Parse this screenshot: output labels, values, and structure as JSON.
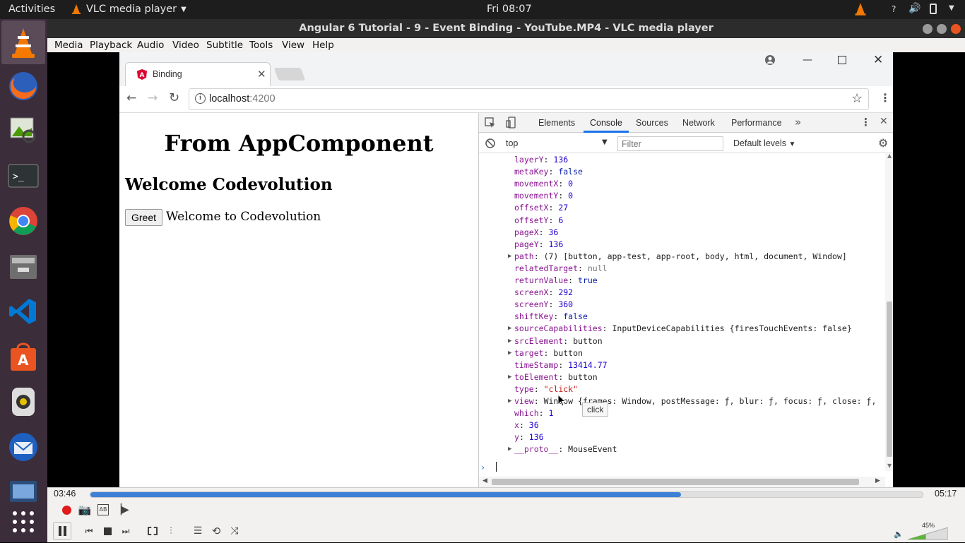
{
  "topbar": {
    "activities": "Activities",
    "app_menu": "VLC media player",
    "clock": "Fri 08:07"
  },
  "window": {
    "title": "Angular 6 Tutorial - 9 - Event Binding - YouTube.MP4 - VLC media player"
  },
  "menu": [
    "Media",
    "Playback",
    "Audio",
    "Video",
    "Subtitle",
    "Tools",
    "View",
    "Help"
  ],
  "browser": {
    "tab_title": "Binding",
    "url_host": "localhost",
    "url_port": ":4200"
  },
  "page": {
    "heading": "From AppComponent",
    "subheading": "Welcome Codevolution",
    "button_label": "Greet",
    "message": "Welcome to Codevolution"
  },
  "devtools": {
    "tabs": [
      "Elements",
      "Console",
      "Sources",
      "Network",
      "Performance"
    ],
    "active_tab": "Console",
    "context": "top",
    "filter_placeholder": "Filter",
    "levels": "Default levels",
    "tooltip": "click",
    "log": [
      {
        "key": "layerY",
        "val": "136",
        "type": "num"
      },
      {
        "key": "metaKey",
        "val": "false",
        "type": "kw"
      },
      {
        "key": "movementX",
        "val": "0",
        "type": "num"
      },
      {
        "key": "movementY",
        "val": "0",
        "type": "num"
      },
      {
        "key": "offsetX",
        "val": "27",
        "type": "num"
      },
      {
        "key": "offsetY",
        "val": "6",
        "type": "num"
      },
      {
        "key": "pageX",
        "val": "36",
        "type": "num"
      },
      {
        "key": "pageY",
        "val": "136",
        "type": "num"
      },
      {
        "key": "path",
        "val": "(7) [button, app-test, app-root, body, html, document, Window]",
        "type": "plain",
        "expand": true
      },
      {
        "key": "relatedTarget",
        "val": "null",
        "type": "gray"
      },
      {
        "key": "returnValue",
        "val": "true",
        "type": "kw"
      },
      {
        "key": "screenX",
        "val": "292",
        "type": "num"
      },
      {
        "key": "screenY",
        "val": "360",
        "type": "num"
      },
      {
        "key": "shiftKey",
        "val": "false",
        "type": "kw"
      },
      {
        "key": "sourceCapabilities",
        "val": "InputDeviceCapabilities {firesTouchEvents: false}",
        "type": "plain",
        "expand": true
      },
      {
        "key": "srcElement",
        "val": "button",
        "type": "plain",
        "expand": true
      },
      {
        "key": "target",
        "val": "button",
        "type": "plain",
        "expand": true
      },
      {
        "key": "timeStamp",
        "val": "13414.77",
        "type": "num"
      },
      {
        "key": "toElement",
        "val": "button",
        "type": "plain",
        "expand": true
      },
      {
        "key": "type",
        "val": "\"click\"",
        "type": "str"
      },
      {
        "key": "view",
        "val": "Window {frames: Window, postMessage: ƒ, blur: ƒ, focus: ƒ, close: ƒ,",
        "type": "plain",
        "expand": true
      },
      {
        "key": "which",
        "val": "1",
        "type": "num"
      },
      {
        "key": "x",
        "val": "36",
        "type": "num"
      },
      {
        "key": "y",
        "val": "136",
        "type": "num"
      },
      {
        "key": "__proto__",
        "val": "MouseEvent",
        "type": "plain",
        "expand": true
      }
    ]
  },
  "player": {
    "elapsed": "03:46",
    "total": "05:17",
    "progress": 0.71,
    "volume": "45%"
  },
  "colors": {
    "accent_orange": "#f57900",
    "vlc_blue": "#3d80d6",
    "record_red": "#e01b1b"
  }
}
